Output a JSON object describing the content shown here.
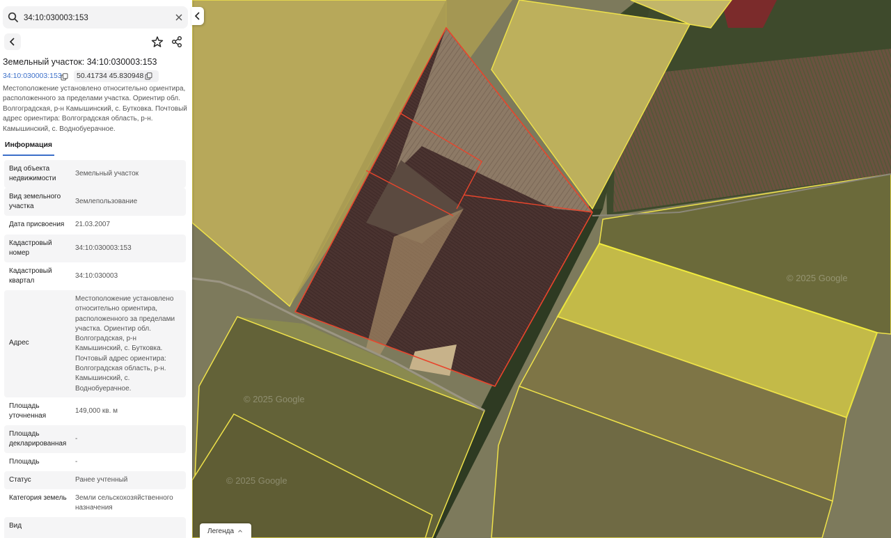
{
  "search": {
    "value": "34:10:030003:153"
  },
  "parcel": {
    "title": "Земельный участок: 34:10:030003:153",
    "cad_number": "34:10:030003:153",
    "coords": "50.41734 45.830948",
    "description": "Местоположение установлено относительно ориентира, расположенного за пределами участка. Ориентир обл. Волгоградская, р-н Камышинский, с. Бутковка. Почтовый адрес ориентира: Волгоградская область, р-н. Камышинский, с. Воднобуерачное."
  },
  "tabs": {
    "info": "Информация"
  },
  "info_rows": [
    {
      "key": "Вид объекта недвижимости",
      "value": "Земельный участок"
    },
    {
      "key": "Вид земельного участка",
      "value": "Землепользование"
    },
    {
      "key": "Дата присвоения",
      "value": "21.03.2007"
    },
    {
      "key": "Кадастровый номер",
      "value": "34:10:030003:153"
    },
    {
      "key": "Кадастровый квартал",
      "value": "34:10:030003"
    },
    {
      "key": "Адрес",
      "value": "Местоположение установлено относительно ориентира, расположенного за пределами участка. Ориентир обл. Волгоградская, р-н Камышинский, с. Бутковка. Почтовый адрес ориентира: Волгоградская область, р-н. Камышинский, с. Воднобуерачное."
    },
    {
      "key": "Площадь уточненная",
      "value": "149,000 кв. м"
    },
    {
      "key": "Площадь декларированная",
      "value": "-"
    },
    {
      "key": "Площадь",
      "value": "-"
    },
    {
      "key": "Статус",
      "value": "Ранее учтенный"
    },
    {
      "key": "Категория земель",
      "value": "Земли сельскохозяйственного назначения"
    },
    {
      "key": "Вид",
      "value": ""
    }
  ],
  "map": {
    "legend_label": "Легенда",
    "watermark": "© 2025 Google",
    "colors": {
      "parcel_outline_selected": "#e8452c",
      "parcel_outline": "#f2e23a",
      "parcel_fill": "#d9c84a",
      "highlight_fill": "#f4ee3c"
    }
  },
  "icons": [
    "search-icon",
    "close-icon",
    "chevron-left-icon",
    "star-icon",
    "share-icon",
    "copy-icon",
    "chevron-up-icon"
  ]
}
